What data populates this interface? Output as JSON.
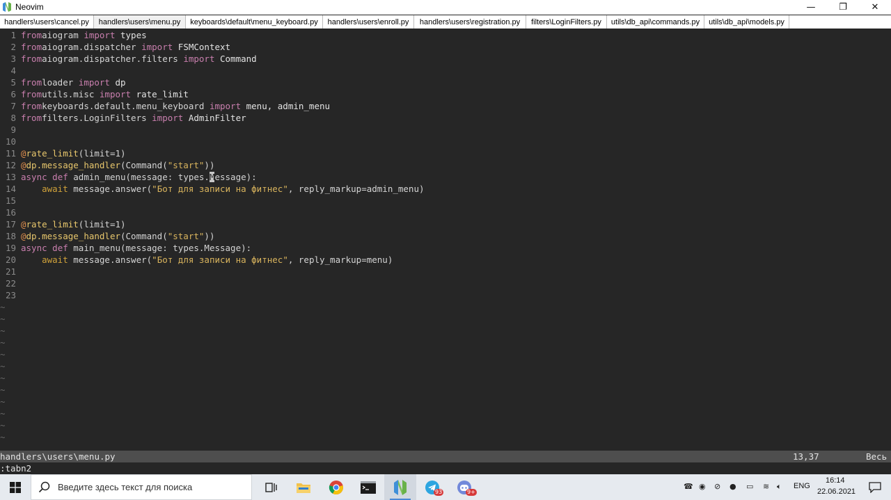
{
  "window": {
    "title": "Neovim",
    "minimize": "—",
    "maximize": "❐",
    "close": "✕"
  },
  "tabs": [
    "handlers\\users\\cancel.py",
    "handlers\\users\\menu.py",
    "keyboards\\default\\menu_keyboard.py",
    "handlers\\users\\enroll.py",
    "handlers\\users\\registration.py",
    "filters\\LoginFilters.py",
    "utils\\db_api\\commands.py",
    "utils\\db_api\\models.py"
  ],
  "active_tab": 1,
  "code_lines": [
    [
      [
        "kw",
        "from"
      ],
      [
        "",
        "aiogram "
      ],
      [
        "kw",
        "import"
      ],
      [
        "mod",
        " types"
      ]
    ],
    [
      [
        "kw",
        "from"
      ],
      [
        "",
        "aiogram.dispatcher "
      ],
      [
        "kw",
        "import"
      ],
      [
        "mod",
        " FSMContext"
      ]
    ],
    [
      [
        "kw",
        "from"
      ],
      [
        "",
        "aiogram.dispatcher.filters "
      ],
      [
        "kw",
        "import"
      ],
      [
        "mod",
        " Command"
      ]
    ],
    [],
    [
      [
        "kw",
        "from"
      ],
      [
        "",
        "loader "
      ],
      [
        "kw",
        "import"
      ],
      [
        "mod",
        " dp"
      ]
    ],
    [
      [
        "kw",
        "from"
      ],
      [
        "",
        "utils.misc "
      ],
      [
        "kw",
        "import"
      ],
      [
        "mod",
        " rate_limit"
      ]
    ],
    [
      [
        "kw",
        "from"
      ],
      [
        "",
        "keyboards.default.menu_keyboard "
      ],
      [
        "kw",
        "import"
      ],
      [
        "mod",
        " menu, admin_menu"
      ]
    ],
    [
      [
        "kw",
        "from"
      ],
      [
        "",
        "filters.LoginFilters "
      ],
      [
        "kw",
        "import"
      ],
      [
        "mod",
        " AdminFilter"
      ]
    ],
    [],
    [],
    [
      [
        "dec",
        "@"
      ],
      [
        "fn",
        "rate_limit"
      ],
      [
        "",
        "(limit=1)"
      ]
    ],
    [
      [
        "dec",
        "@"
      ],
      [
        "fn",
        "dp.message_handler"
      ],
      [
        "",
        "(Command("
      ],
      [
        "str",
        "\"start\""
      ],
      [
        "",
        "))"
      ]
    ],
    [
      [
        "kw",
        "async"
      ],
      [
        "",
        " "
      ],
      [
        "kw",
        "def"
      ],
      [
        "",
        " admin_menu(message: types."
      ],
      [
        "cursor",
        "M"
      ],
      [
        "",
        "essage):"
      ]
    ],
    [
      [
        "",
        "    "
      ],
      [
        "aw",
        "await"
      ],
      [
        "",
        " message.answer("
      ],
      [
        "str",
        "\"Бот для записи на фитнес\""
      ],
      [
        "",
        ", reply_markup=admin_menu)"
      ]
    ],
    [],
    [],
    [
      [
        "dec",
        "@"
      ],
      [
        "fn",
        "rate_limit"
      ],
      [
        "",
        "(limit=1)"
      ]
    ],
    [
      [
        "dec",
        "@"
      ],
      [
        "fn",
        "dp.message_handler"
      ],
      [
        "",
        "(Command("
      ],
      [
        "str",
        "\"start\""
      ],
      [
        "",
        "))"
      ]
    ],
    [
      [
        "kw",
        "async"
      ],
      [
        "",
        " "
      ],
      [
        "kw",
        "def"
      ],
      [
        "",
        " main_menu(message: types.Message):"
      ]
    ],
    [
      [
        "",
        "    "
      ],
      [
        "aw",
        "await"
      ],
      [
        "",
        " message.answer("
      ],
      [
        "str",
        "\"Бот для записи на фитнес\""
      ],
      [
        "",
        ", reply_markup=menu)"
      ]
    ],
    [],
    [],
    []
  ],
  "empty_line_marker": "~",
  "statusline": {
    "file": "handlers\\users\\menu.py",
    "position": "13,37",
    "scroll": "Весь"
  },
  "cmdline": ":tabn2",
  "taskbar": {
    "search_placeholder": "Введите здесь текст для поиска",
    "telegram_badge": "93",
    "discord_badge": "9+",
    "language": "ENG",
    "time": "16:14",
    "date": "22.06.2021"
  }
}
